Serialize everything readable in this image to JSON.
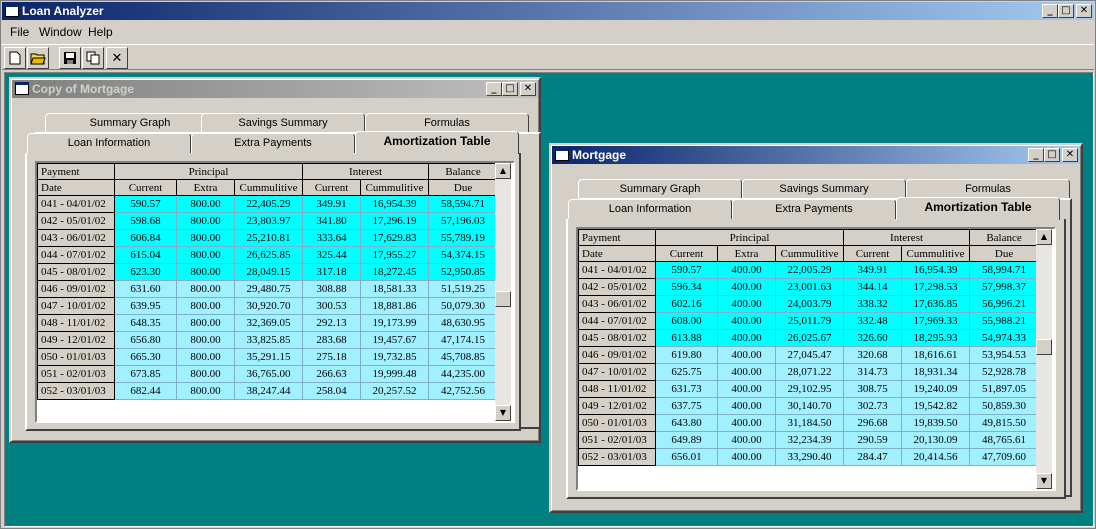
{
  "app": {
    "title": "Loan Analyzer",
    "menu": [
      "File",
      "Window",
      "Help"
    ],
    "toolbar": [
      "new-icon",
      "open-icon",
      "save-icon",
      "copy-icon",
      "close-icon"
    ]
  },
  "tabs_row1": [
    "Summary Graph",
    "Savings Summary",
    "Formulas"
  ],
  "tabs_row2": [
    "Loan Information",
    "Extra Payments",
    "Amortization Table"
  ],
  "table_headers": {
    "payment": "Payment",
    "date": "Date",
    "principal": "Principal",
    "interest": "Interest",
    "balance": "Balance",
    "current": "Current",
    "extra": "Extra",
    "cumulative": "Cummulitive",
    "due": "Due"
  },
  "windows": [
    {
      "title": "Copy of Mortgage",
      "rows": [
        [
          "041 - 04/01/02",
          "590.57",
          "800.00",
          "22,405.29",
          "349.91",
          "16,954.39",
          "58,594.71"
        ],
        [
          "042 - 05/01/02",
          "598.68",
          "800.00",
          "23,803.97",
          "341.80",
          "17,296.19",
          "57,196.03"
        ],
        [
          "043 - 06/01/02",
          "606.84",
          "800.00",
          "25,210.81",
          "333.64",
          "17,629.83",
          "55,789.19"
        ],
        [
          "044 - 07/01/02",
          "615.04",
          "800.00",
          "26,625.85",
          "325.44",
          "17,955.27",
          "54,374.15"
        ],
        [
          "045 - 08/01/02",
          "623.30",
          "800.00",
          "28,049.15",
          "317.18",
          "18,272.45",
          "52,950.85"
        ],
        [
          "046 - 09/01/02",
          "631.60",
          "800.00",
          "29,480.75",
          "308.88",
          "18,581.33",
          "51,519.25"
        ],
        [
          "047 - 10/01/02",
          "639.95",
          "800.00",
          "30,920.70",
          "300.53",
          "18,881.86",
          "50,079.30"
        ],
        [
          "048 - 11/01/02",
          "648.35",
          "800.00",
          "32,369.05",
          "292.13",
          "19,173.99",
          "48,630.95"
        ],
        [
          "049 - 12/01/02",
          "656.80",
          "800.00",
          "33,825.85",
          "283.68",
          "19,457.67",
          "47,174.15"
        ],
        [
          "050 - 01/01/03",
          "665.30",
          "800.00",
          "35,291.15",
          "275.18",
          "19,732.85",
          "45,708.85"
        ],
        [
          "051 - 02/01/03",
          "673.85",
          "800.00",
          "36,765.00",
          "266.63",
          "19,999.48",
          "44,235.00"
        ],
        [
          "052 - 03/01/03",
          "682.44",
          "800.00",
          "38,247.44",
          "258.04",
          "20,257.52",
          "42,752.56"
        ]
      ],
      "highlighted_rows": 5
    },
    {
      "title": "Mortgage",
      "rows": [
        [
          "041 - 04/01/02",
          "590.57",
          "400.00",
          "22,005.29",
          "349.91",
          "16,954.39",
          "58,994.71"
        ],
        [
          "042 - 05/01/02",
          "596.34",
          "400.00",
          "23,001.63",
          "344.14",
          "17,298.53",
          "57,998.37"
        ],
        [
          "043 - 06/01/02",
          "602.16",
          "400.00",
          "24,003.79",
          "338.32",
          "17,636.85",
          "56,996.21"
        ],
        [
          "044 - 07/01/02",
          "608.00",
          "400.00",
          "25,011.79",
          "332.48",
          "17,969.33",
          "55,988.21"
        ],
        [
          "045 - 08/01/02",
          "613.88",
          "400.00",
          "26,025.67",
          "326.60",
          "18,295.93",
          "54,974.33"
        ],
        [
          "046 - 09/01/02",
          "619.80",
          "400.00",
          "27,045.47",
          "320.68",
          "18,616.61",
          "53,954.53"
        ],
        [
          "047 - 10/01/02",
          "625.75",
          "400.00",
          "28,071.22",
          "314.73",
          "18,931.34",
          "52,928.78"
        ],
        [
          "048 - 11/01/02",
          "631.73",
          "400.00",
          "29,102.95",
          "308.75",
          "19,240.09",
          "51,897.05"
        ],
        [
          "049 - 12/01/02",
          "637.75",
          "400.00",
          "30,140.70",
          "302.73",
          "19,542.82",
          "50,859.30"
        ],
        [
          "050 - 01/01/03",
          "643.80",
          "400.00",
          "31,184.50",
          "296.68",
          "19,839.50",
          "49,815.50"
        ],
        [
          "051 - 02/01/03",
          "649.89",
          "400.00",
          "32,234.39",
          "290.59",
          "20,130.09",
          "48,765.61"
        ],
        [
          "052 - 03/01/03",
          "656.01",
          "400.00",
          "33,290.40",
          "284.47",
          "20,414.56",
          "47,709.60"
        ]
      ],
      "highlighted_rows": 5
    }
  ],
  "colors": {
    "highlight": "#00ffff",
    "row": "#a0f0ff",
    "desktop": "#008080",
    "titlebar": "#0a246a"
  }
}
